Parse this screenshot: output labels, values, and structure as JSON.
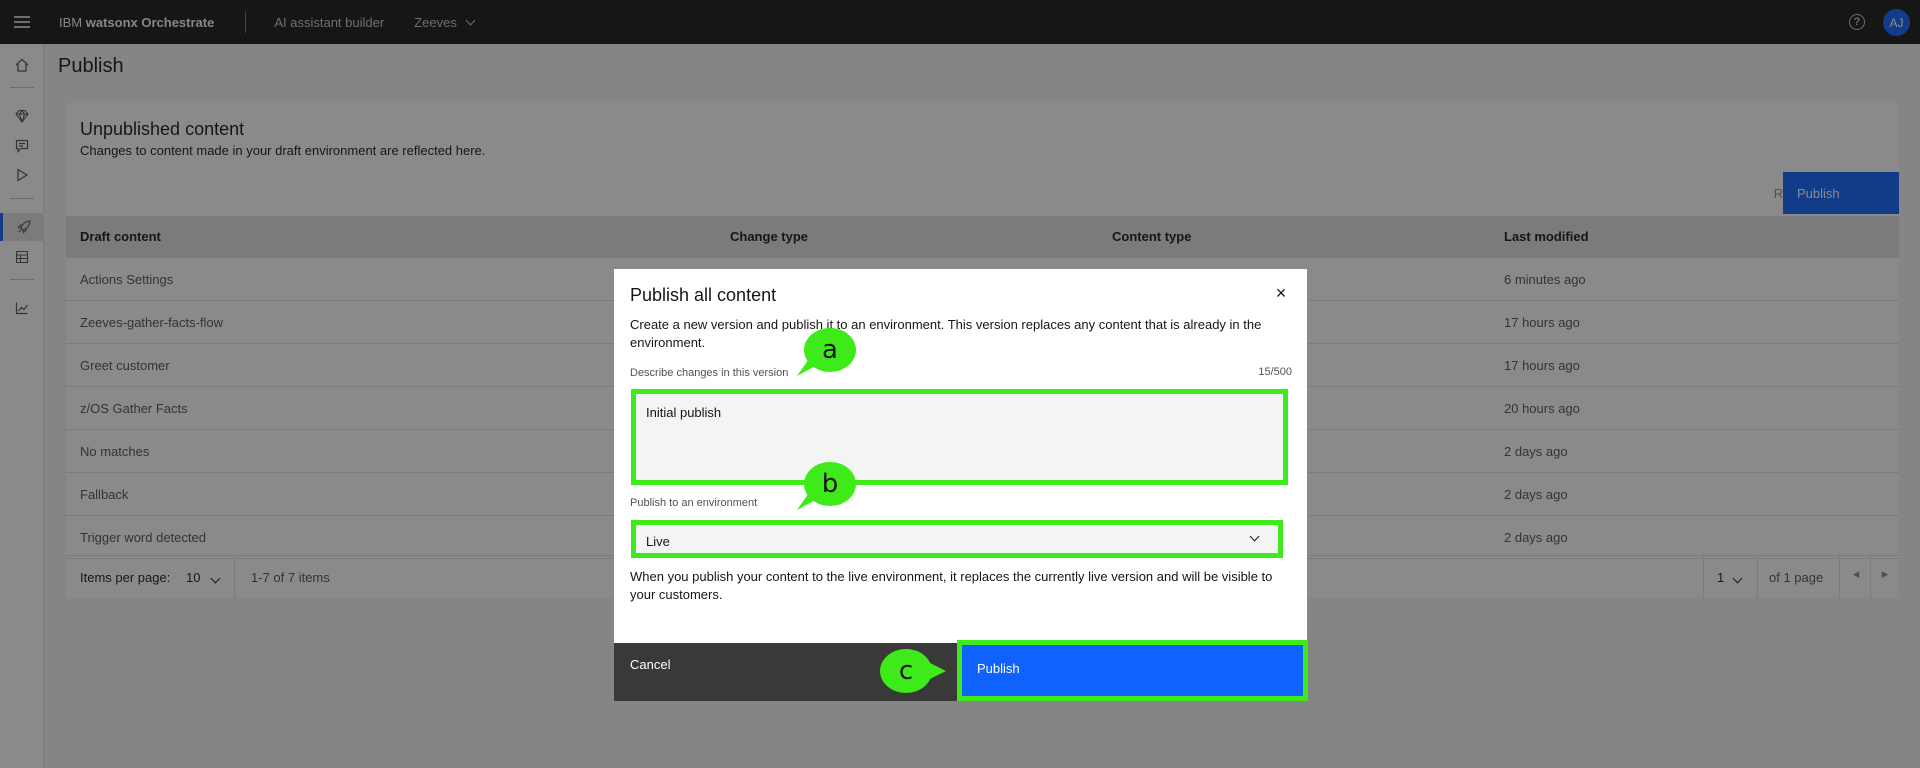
{
  "header": {
    "brand_prefix": "IBM ",
    "brand_product": "watsonx Orchestrate",
    "nav_link": "AI assistant builder",
    "environment": "Zeeves",
    "help_glyph": "?",
    "avatar_initials": "AJ"
  },
  "rail": {
    "items": [
      "home-icon",
      "diamond-icon",
      "chat-icon",
      "play-icon",
      "rocket-icon",
      "table-icon",
      "chart-icon"
    ],
    "active": "rocket-icon"
  },
  "page": {
    "title": "Publish"
  },
  "card": {
    "title": "Unpublished content",
    "subtitle": "Changes to content made in your draft environment are reflected here.",
    "revert_label": "Revert",
    "publish_label": "Publish"
  },
  "table": {
    "columns": [
      "Draft content",
      "Change type",
      "Content type",
      "Last modified"
    ],
    "rows": [
      {
        "name": "Actions Settings",
        "modified": "6 minutes ago"
      },
      {
        "name": "Zeeves-gather-facts-flow",
        "modified": "17 hours ago"
      },
      {
        "name": "Greet customer",
        "modified": "17 hours ago"
      },
      {
        "name": "z/OS Gather Facts",
        "modified": "20 hours ago"
      },
      {
        "name": "No matches",
        "modified": "2 days ago"
      },
      {
        "name": "Fallback",
        "modified": "2 days ago"
      },
      {
        "name": "Trigger word detected",
        "modified": "2 days ago"
      }
    ]
  },
  "pager": {
    "items_per_page_label": "Items per page:",
    "items_per_page": "10",
    "range": "1-7 of 7 items",
    "page": "1",
    "of_pages": "of 1 page"
  },
  "modal": {
    "title": "Publish all content",
    "close_glyph": "×",
    "description": "Create a new version and publish it to an environment. This version replaces any content that is already in the environment.",
    "describe_label": "Describe changes in this version",
    "counter": "15/500",
    "describe_value": "Initial publish",
    "env_label": "Publish to an environment",
    "env_value": "Live",
    "note": "When you publish your content to the live environment, it replaces the currently live version and will be visible to your customers.",
    "cancel_label": "Cancel",
    "publish_label": "Publish"
  },
  "callouts": {
    "a": "a",
    "b": "b",
    "c": "c",
    "color": "#3eea1a"
  },
  "colors": {
    "primary": "#0f62fe",
    "header_bg": "#161616",
    "highlight": "#3eea1a"
  }
}
